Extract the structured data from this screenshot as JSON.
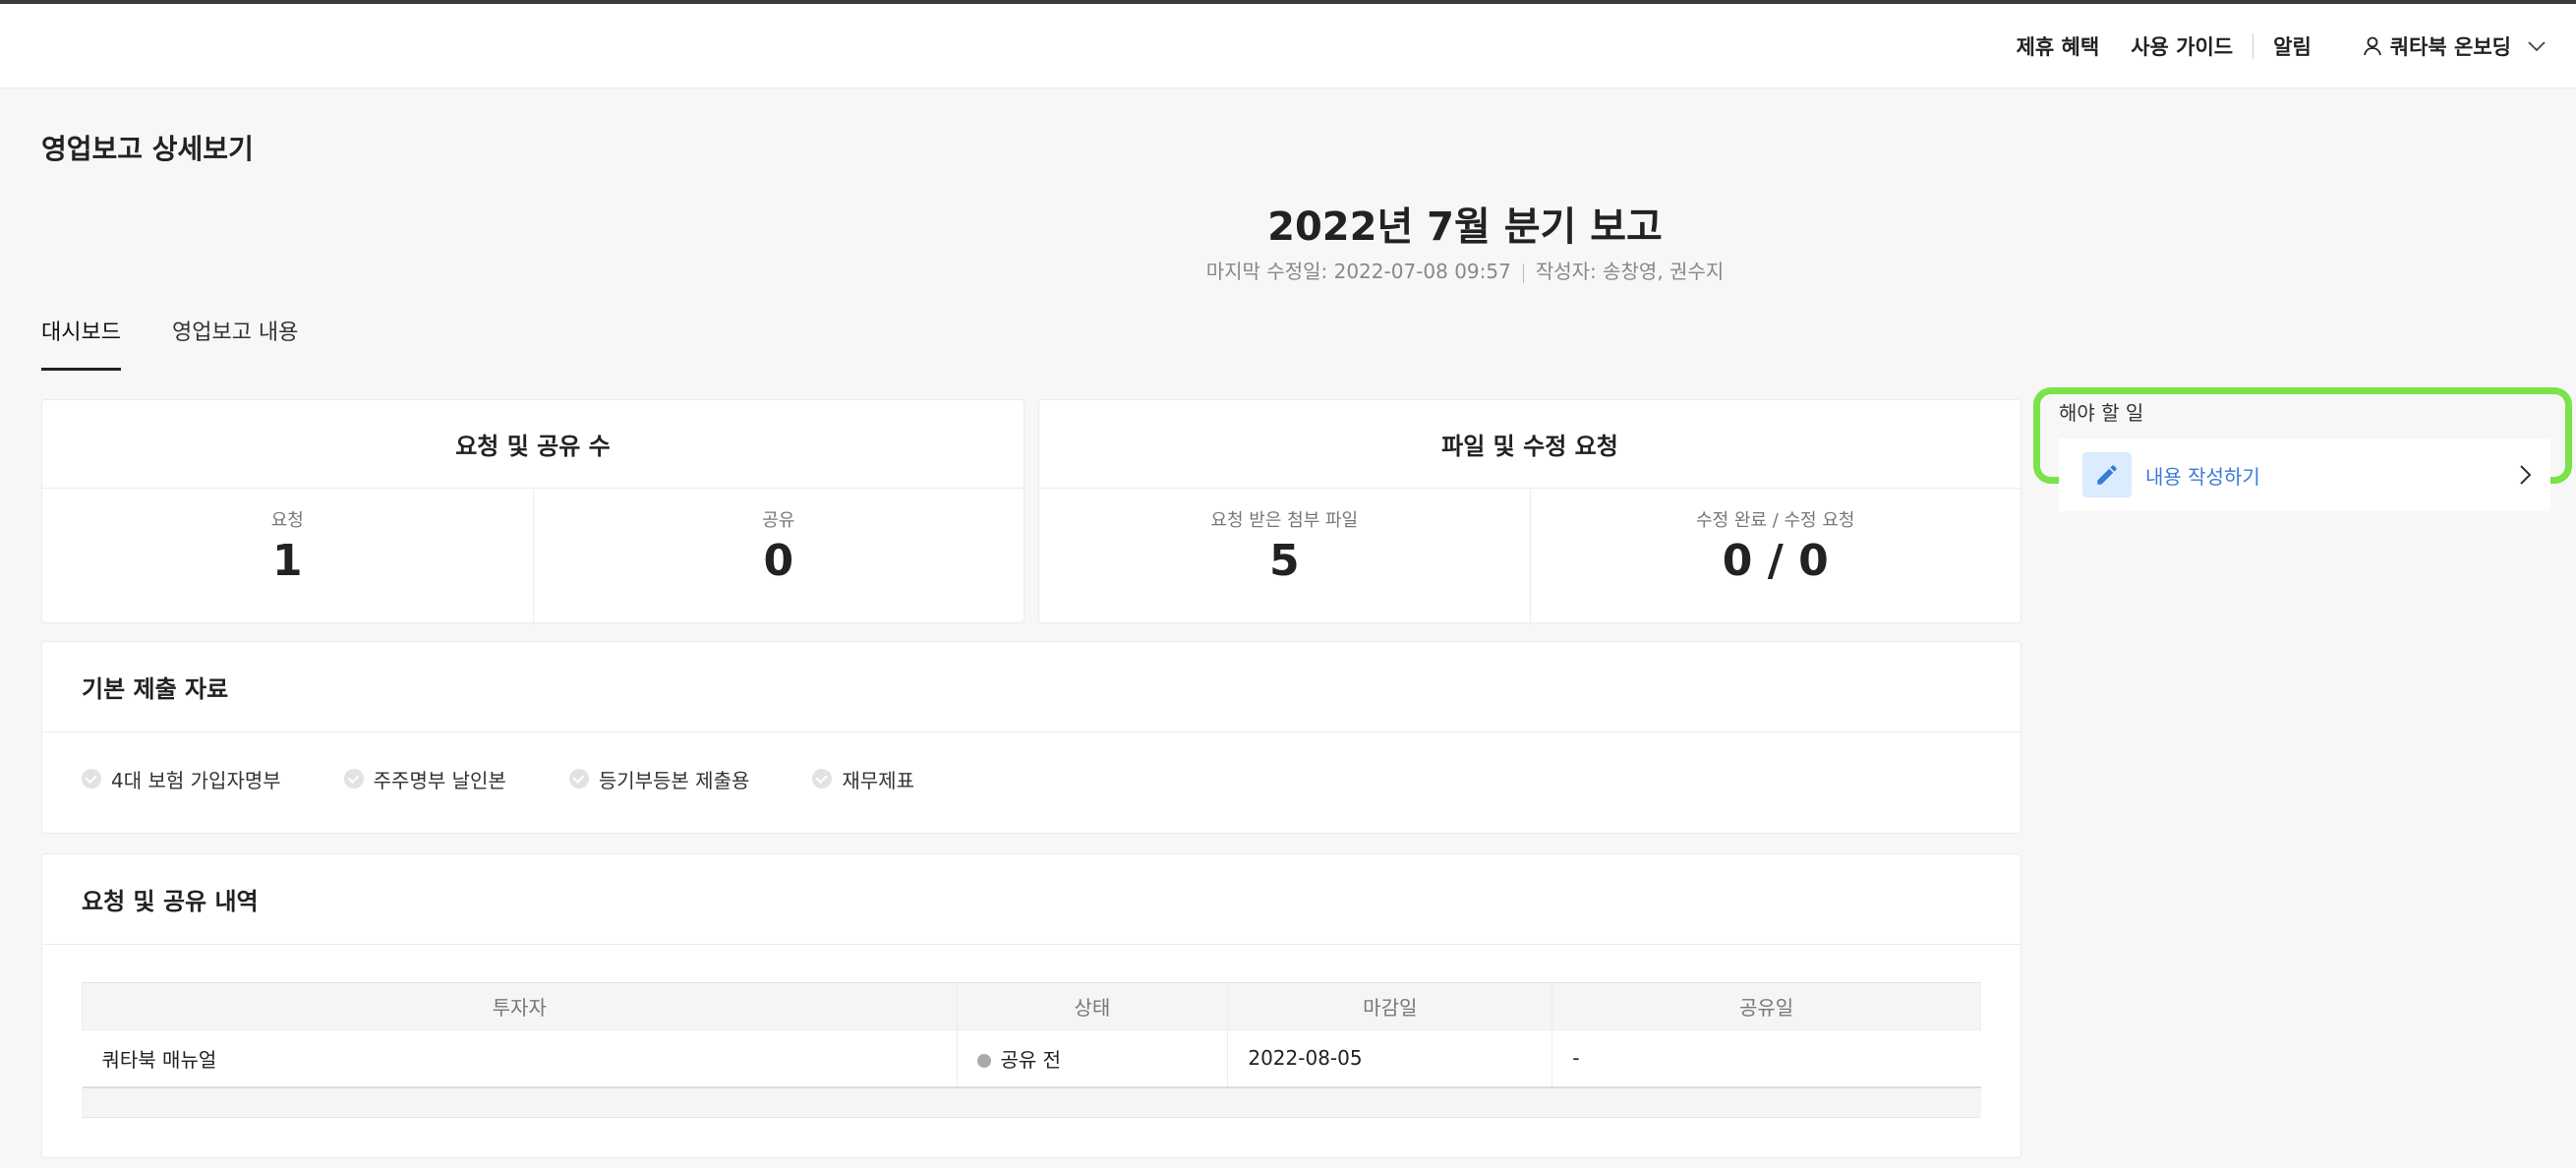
{
  "header": {
    "nav": [
      "제휴 혜택",
      "사용 가이드",
      "알림"
    ],
    "user_name": "쿼타북 온보딩"
  },
  "page": {
    "title": "영업보고 상세보기",
    "report_title": "2022년 7월 분기 보고",
    "last_modified": "마지막 수정일: 2022-07-08 09:57",
    "authors": "작성자: 송창영, 권수지"
  },
  "tabs": [
    "대시보드",
    "영업보고 내용"
  ],
  "stats": {
    "requests_shares": {
      "title": "요청 및 공유 수",
      "request_label": "요청",
      "request_value": "1",
      "share_label": "공유",
      "share_value": "0"
    },
    "files_edits": {
      "title": "파일 및 수정 요청",
      "files_label": "요청 받은 첨부 파일",
      "files_value": "5",
      "edits_label": "수정 완료 / 수정 요청",
      "edits_value": "0 / 0"
    }
  },
  "basic_docs": {
    "title": "기본 제출 자료",
    "items": [
      "4대 보험 가입자명부",
      "주주명부 날인본",
      "등기부등본 제출용",
      "재무제표"
    ]
  },
  "history": {
    "title": "요청 및 공유 내역",
    "columns": [
      "투자자",
      "상태",
      "마감일",
      "공유일"
    ],
    "rows": [
      {
        "investor": "쿼타북 매뉴얼",
        "status": "공유 전",
        "deadline": "2022-08-05",
        "shared": "-"
      }
    ]
  },
  "todo": {
    "title": "해야 할 일",
    "item_label": "내용 작성하기"
  },
  "colors": {
    "accent_blue": "#3a7bd5",
    "highlight_green": "#7be24a",
    "status_gray": "#aaaaaa"
  }
}
